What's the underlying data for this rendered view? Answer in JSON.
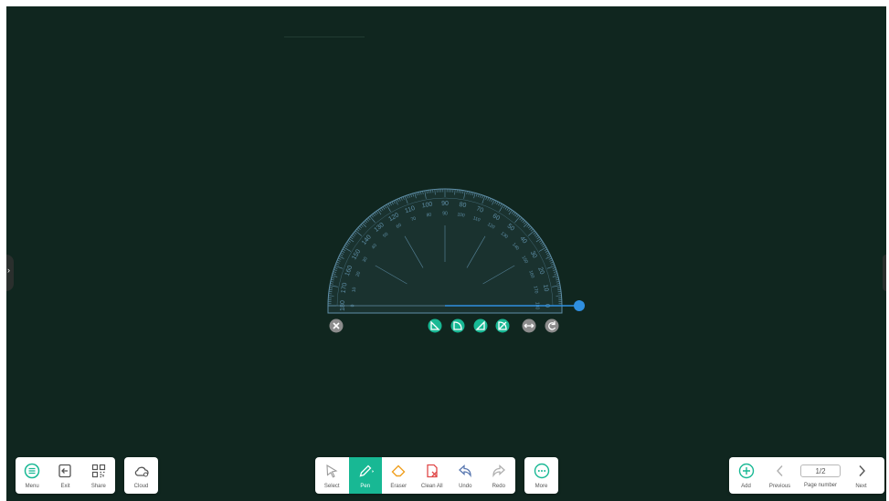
{
  "left_toolbar": {
    "menu_label": "Menu",
    "exit_label": "Exit",
    "share_label": "Share"
  },
  "cloud_toolbar": {
    "cloud_label": "Cloud"
  },
  "center_toolbar": {
    "select_label": "Select",
    "pen_label": "Pen",
    "eraser_label": "Eraser",
    "clean_all_label": "Clean All",
    "undo_label": "Undo",
    "redo_label": "Redo"
  },
  "more_toolbar": {
    "more_label": "More"
  },
  "page_toolbar": {
    "add_label": "Add",
    "previous_label": "Previous",
    "page_number_label": "Page number",
    "page_value": "1/2",
    "next_label": "Next"
  },
  "protractor": {
    "outer_labels": [
      "0",
      "10",
      "20",
      "30",
      "40",
      "50",
      "60",
      "70",
      "80",
      "90",
      "100",
      "110",
      "120",
      "130",
      "140",
      "150",
      "160",
      "170",
      "180"
    ],
    "inner_labels": [
      "180",
      "170",
      "160",
      "150",
      "140",
      "130",
      "120",
      "110",
      "100",
      "90",
      "80",
      "70",
      "60",
      "50",
      "40",
      "30",
      "20",
      "10",
      "0"
    ],
    "tools": [
      "protractor-tool-1-icon",
      "protractor-tool-2-icon",
      "protractor-tool-3-icon",
      "protractor-tool-4-icon",
      "flip-icon",
      "rotate-icon"
    ]
  },
  "colors": {
    "board": "#10261f",
    "accent": "#18b894",
    "protractor_line": "#5f8fa8",
    "handle": "#2f8fe0"
  }
}
